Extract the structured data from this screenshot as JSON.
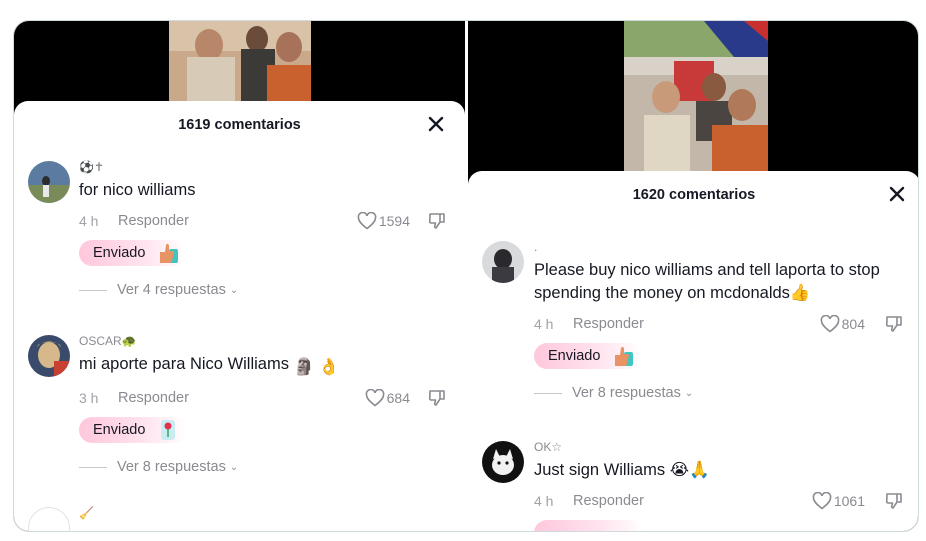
{
  "left": {
    "title": "1619 comentarios",
    "comments": [
      {
        "username": "⚽✝",
        "text": "for nico williams",
        "time": "4 h",
        "reply": "Responder",
        "likes": "1594",
        "chip": "Enviado",
        "view_replies": "Ver 4 respuestas"
      },
      {
        "username": "OSCAR🐢",
        "text": "mi aporte para Nico Williams",
        "time": "3 h",
        "reply": "Responder",
        "likes": "684",
        "chip": "Enviado",
        "view_replies": "Ver 8 respuestas"
      },
      {
        "username": "🧹"
      }
    ]
  },
  "right": {
    "title": "1620 comentarios",
    "comments": [
      {
        "username": ".",
        "text": "Please buy nico williams and tell laporta to stop spending the money on mcdonalds👍",
        "time": "4 h",
        "reply": "Responder",
        "likes": "804",
        "chip": "Enviado",
        "view_replies": "Ver 8 respuestas"
      },
      {
        "username": "OK☆",
        "text": "Just sign Williams 😭🙏",
        "time": "4 h",
        "reply": "Responder",
        "likes": "1061"
      }
    ]
  },
  "colors": {
    "chip_pink": "#ffc7dc",
    "muted_text": "#8a8b91",
    "primary_text": "#161823"
  }
}
